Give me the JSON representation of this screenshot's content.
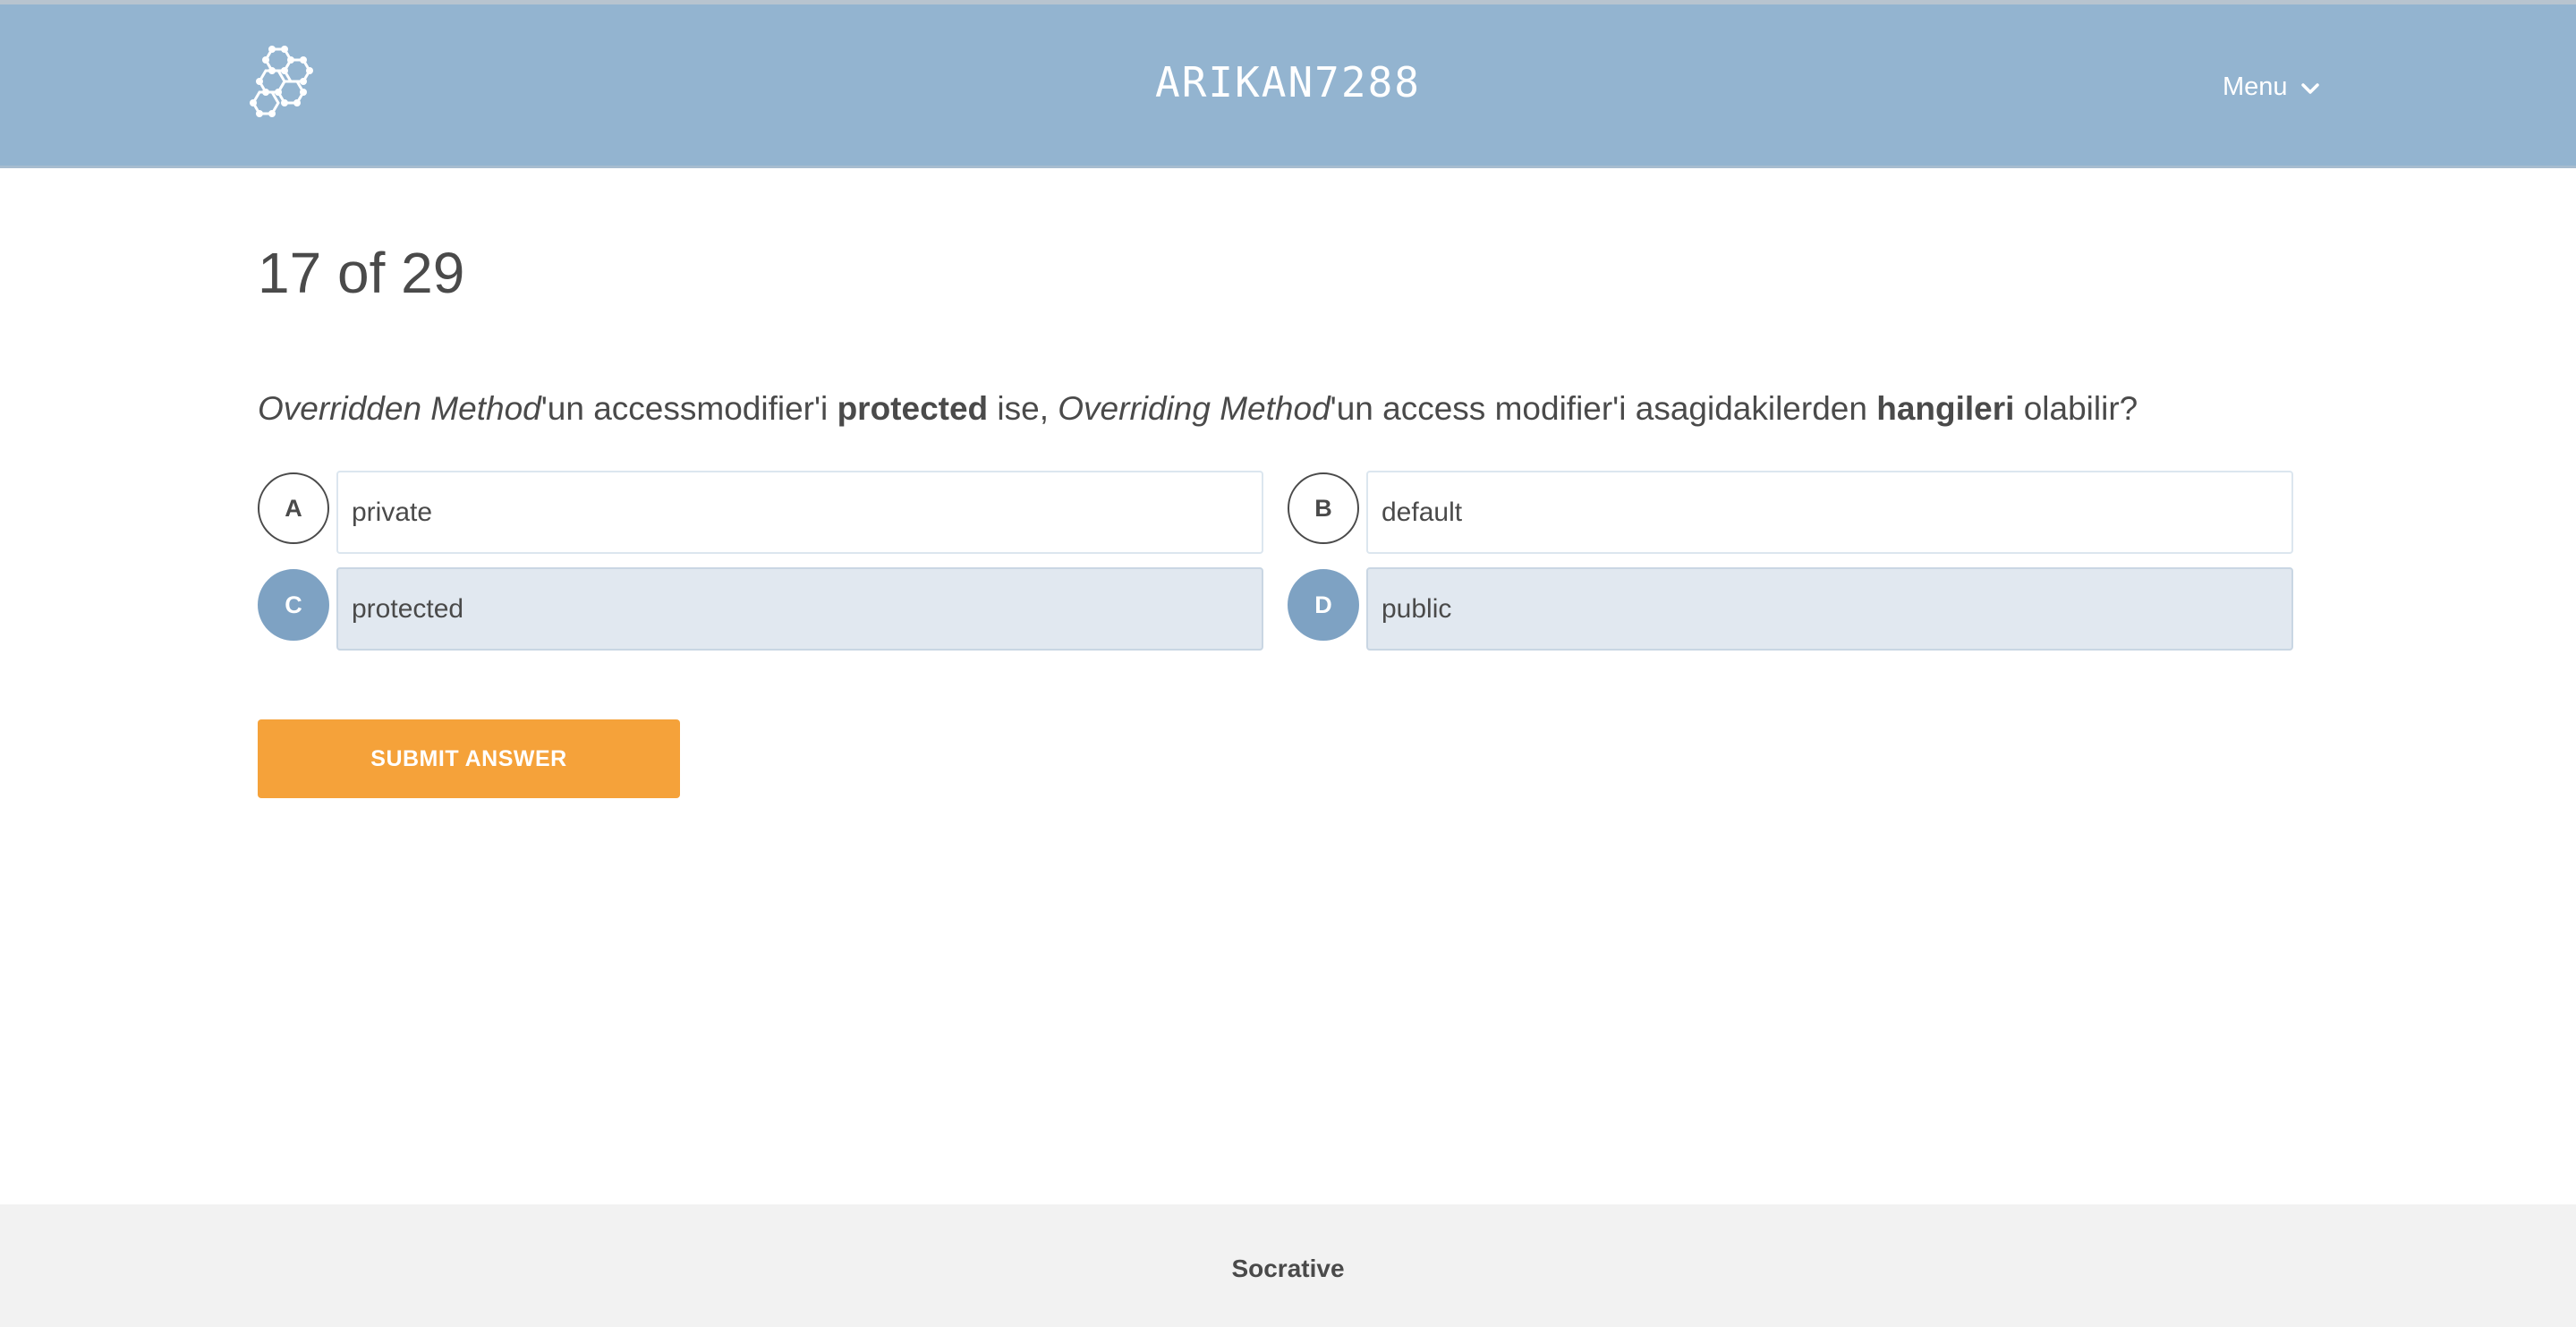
{
  "header": {
    "room_name": "ARIKAN7288",
    "menu_label": "Menu",
    "logo_icon": "hexagon-cluster-icon",
    "menu_icon": "chevron-down-icon",
    "background_color": "#93b4d0"
  },
  "quiz": {
    "progress": "17 of 29",
    "question_parts": [
      {
        "text": "Overridden Method",
        "style": "italic"
      },
      {
        "text": "'un accessmodifier'i ",
        "style": "normal"
      },
      {
        "text": "protected",
        "style": "bold"
      },
      {
        "text": " ise, ",
        "style": "normal"
      },
      {
        "text": "Overriding Method",
        "style": "italic"
      },
      {
        "text": "'un access modifier'i asagidakilerden ",
        "style": "normal"
      },
      {
        "text": "hangileri",
        "style": "bold"
      },
      {
        "text": " olabilir?",
        "style": "normal"
      }
    ],
    "options": [
      {
        "letter": "A",
        "text": "private",
        "selected": false
      },
      {
        "letter": "B",
        "text": "default",
        "selected": false
      },
      {
        "letter": "C",
        "text": "protected",
        "selected": true
      },
      {
        "letter": "D",
        "text": "public",
        "selected": true
      }
    ],
    "submit_label": "SUBMIT ANSWER",
    "accent_color": "#f5a23a",
    "selected_color": "#7ea2c3"
  },
  "footer": {
    "brand": "Socrative"
  }
}
